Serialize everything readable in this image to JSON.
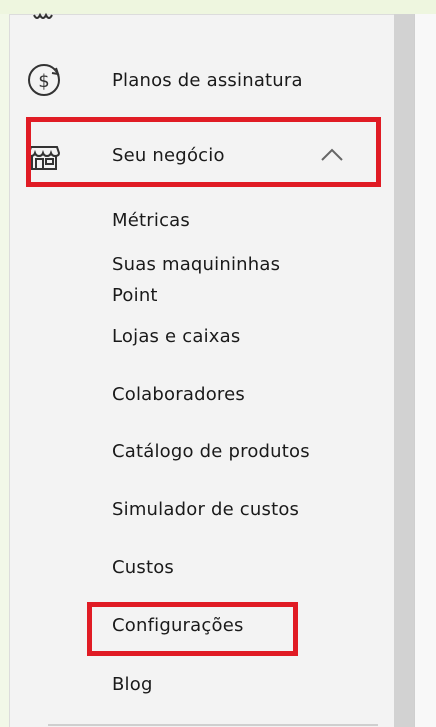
{
  "menu": {
    "items": [
      {
        "label": "Planos de assinatura",
        "icon": "dollar-circle-icon"
      },
      {
        "label": "Seu negócio",
        "icon": "store-icon",
        "expanded": true
      }
    ],
    "submenu": [
      "Métricas",
      "Suas maquininhas",
      "Point",
      "Lojas e caixas",
      "Colaboradores",
      "Catálogo de produtos",
      "Simulador de custos",
      "Custos",
      "Configurações",
      "Blog"
    ]
  },
  "colors": {
    "highlight": "#e01b24",
    "panel": "#f3f3f3",
    "scrollbar": "#d2d2d2"
  }
}
